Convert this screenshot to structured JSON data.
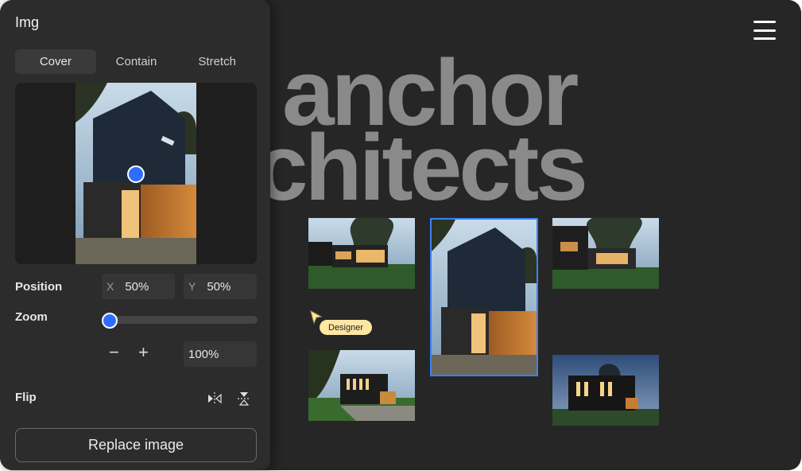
{
  "canvas": {
    "hero_line1": "anchor",
    "hero_line2": "rchitects",
    "menu_icon": "hamburger-menu-icon"
  },
  "cursor": {
    "badge": "Designer",
    "color": "#fde7a3"
  },
  "panel": {
    "title": "Img",
    "tabs": [
      {
        "label": "Cover",
        "active": true
      },
      {
        "label": "Contain",
        "active": false
      },
      {
        "label": "Stretch",
        "active": false
      }
    ],
    "position": {
      "label": "Position",
      "x_prefix": "X",
      "x_value": "50%",
      "y_prefix": "Y",
      "y_value": "50%"
    },
    "zoom": {
      "label": "Zoom",
      "level": 0,
      "minus": "−",
      "plus": "+",
      "value": "100%"
    },
    "flip": {
      "label": "Flip",
      "horizontal_icon": "flip-horizontal-icon",
      "vertical_icon": "flip-vertical-icon"
    },
    "replace_label": "Replace image"
  },
  "colors": {
    "accent": "#2f6dff",
    "selection": "#3b82f6",
    "panel_bg": "#2c2c2c",
    "canvas_bg": "#262626"
  }
}
